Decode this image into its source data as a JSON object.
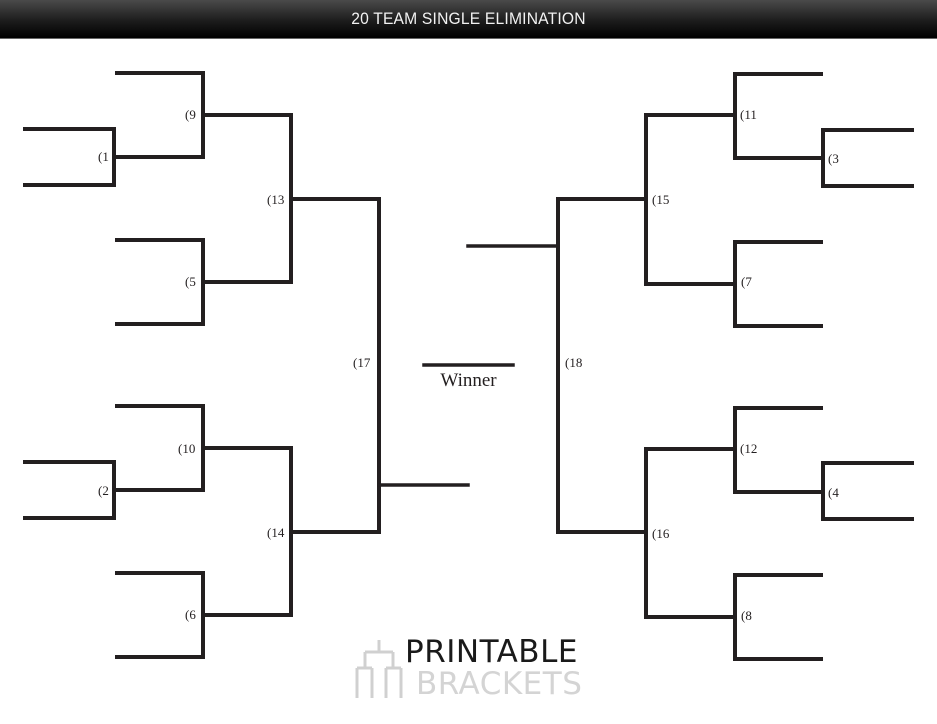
{
  "header": {
    "title": "20 TEAM SINGLE ELIMINATION"
  },
  "bracket": {
    "games": {
      "g1": "(1",
      "g2": "(2",
      "g3": "(3",
      "g4": "(4",
      "g5": "(5",
      "g6": "(6",
      "g7": "(7",
      "g8": "(8",
      "g9": "(9",
      "g10": "(10",
      "g11": "(11",
      "g12": "(12",
      "g13": "(13",
      "g14": "(14",
      "g15": "(15",
      "g16": "(16",
      "g17": "(17",
      "g18": "(18"
    },
    "winner_label": "Winner"
  },
  "logo": {
    "line1": "PRINTABLE",
    "line2": "BRACKETS",
    "icon": "bracket-tree-icon"
  }
}
